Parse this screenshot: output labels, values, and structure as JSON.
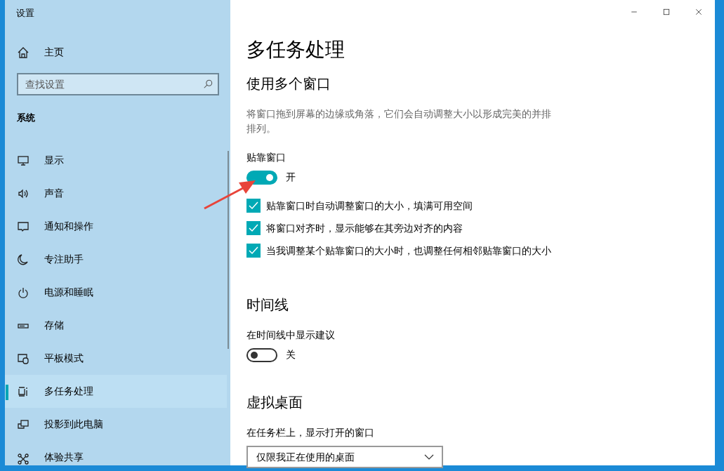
{
  "window": {
    "title": "设置"
  },
  "sidebar": {
    "home": "主页",
    "search": {
      "placeholder": "查找设置"
    },
    "section": "系统",
    "items": [
      {
        "label": "显示",
        "selected": false
      },
      {
        "label": "声音",
        "selected": false
      },
      {
        "label": "通知和操作",
        "selected": false
      },
      {
        "label": "专注助手",
        "selected": false
      },
      {
        "label": "电源和睡眠",
        "selected": false
      },
      {
        "label": "存储",
        "selected": false
      },
      {
        "label": "平板模式",
        "selected": false
      },
      {
        "label": "多任务处理",
        "selected": true
      },
      {
        "label": "投影到此电脑",
        "selected": false
      },
      {
        "label": "体验共享",
        "selected": false
      }
    ]
  },
  "page": {
    "title": "多任务处理",
    "sections": [
      {
        "heading": "使用多个窗口",
        "items": [
          {
            "kind": "description",
            "text": "将窗口拖到屏幕的边缘或角落，它们会自动调整大小以形成完美的并排排列。"
          },
          {
            "kind": "toggle",
            "label": "贴靠窗口",
            "on": true,
            "state_text": "开"
          },
          {
            "kind": "checkbox",
            "label": "贴靠窗口时自动调整窗口的大小，填满可用空间",
            "checked": true
          },
          {
            "kind": "checkbox",
            "label": "将窗口对齐时，显示能够在其旁边对齐的内容",
            "checked": true
          },
          {
            "kind": "checkbox",
            "label": "当我调整某个贴靠窗口的大小时，也调整任何相邻贴靠窗口的大小",
            "checked": true
          }
        ]
      },
      {
        "heading": "时间线",
        "items": [
          {
            "kind": "toggle",
            "label": "在时间线中显示建议",
            "on": false,
            "state_text": "关"
          }
        ]
      },
      {
        "heading": "虚拟桌面",
        "items": [
          {
            "kind": "dropdown",
            "label": "在任务栏上，显示打开的窗口",
            "value": "仅限我正在使用的桌面"
          }
        ]
      }
    ]
  }
}
